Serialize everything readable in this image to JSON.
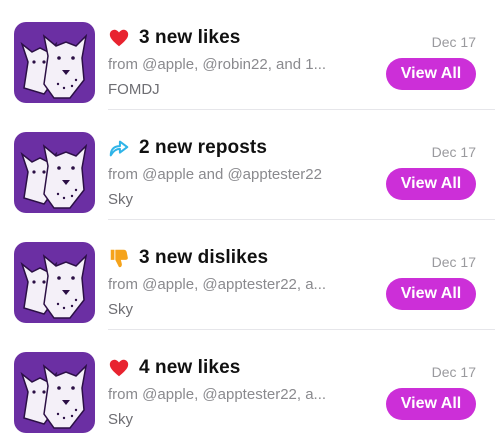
{
  "notifications": [
    {
      "icon": "heart-icon",
      "title": "3 new likes",
      "from": "from @apple, @robin22, and 1...",
      "sub": "FOMDJ",
      "date": "Dec 17",
      "button": "View All"
    },
    {
      "icon": "repost-icon",
      "title": "2 new reposts",
      "from": "from @apple and @apptester22",
      "sub": "Sky",
      "date": "Dec 17",
      "button": "View All"
    },
    {
      "icon": "thumbs-down-icon",
      "title": "3 new dislikes",
      "from": "from @apple, @apptester22, a...",
      "sub": "Sky",
      "date": "Dec 17",
      "button": "View All"
    },
    {
      "icon": "heart-icon",
      "title": "4 new likes",
      "from": "from @apple, @apptester22, a...",
      "sub": "Sky",
      "date": "Dec 17",
      "button": "View All"
    }
  ],
  "colors": {
    "accent_button": "#cc2fd8",
    "avatar_bg": "#6b2fa3",
    "heart": "#e8232f",
    "repost": "#2fb4e8",
    "thumbs_down": "#f5a31b"
  }
}
